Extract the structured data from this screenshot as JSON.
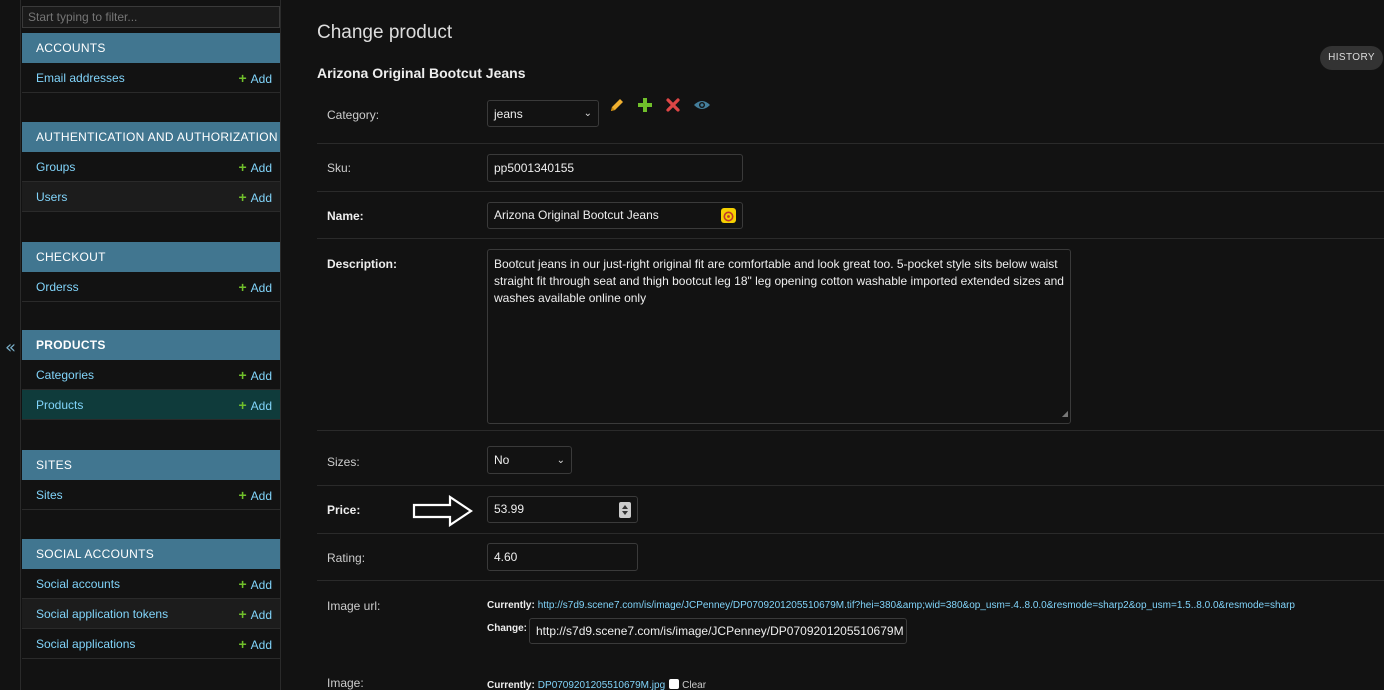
{
  "nav": {
    "filter_placeholder": "Start typing to filter...",
    "collapse_glyph": "«",
    "add_label": "Add",
    "modules": [
      {
        "caption": "ACCOUNTS",
        "models": [
          "Email addresses"
        ]
      },
      {
        "caption": "AUTHENTICATION AND AUTHORIZATION",
        "models": [
          "Groups",
          "Users"
        ]
      },
      {
        "caption": "CHECKOUT",
        "models": [
          "Orderss"
        ]
      },
      {
        "caption": "PRODUCTS",
        "models": [
          "Categories",
          "Products"
        ]
      },
      {
        "caption": "SITES",
        "models": [
          "Sites"
        ]
      },
      {
        "caption": "SOCIAL ACCOUNTS",
        "models": [
          "Social accounts",
          "Social application tokens",
          "Social applications"
        ]
      }
    ]
  },
  "main": {
    "page_title": "Change product",
    "history_label": "HISTORY",
    "object_title": "Arizona Original Bootcut Jeans"
  },
  "form": {
    "category": {
      "label": "Category:",
      "value": "jeans"
    },
    "sku": {
      "label": "Sku:",
      "value": "pp5001340155"
    },
    "name": {
      "label": "Name:",
      "value": "Arizona Original Bootcut Jeans"
    },
    "description": {
      "label": "Description:",
      "value": "Bootcut jeans in our just-right original fit are comfortable and look great too. 5-pocket style sits below waist straight fit through seat and thigh bootcut leg 18\" leg opening cotton washable imported extended sizes and washes available online only"
    },
    "sizes": {
      "label": "Sizes:",
      "value": "No"
    },
    "price": {
      "label": "Price:",
      "value": "53.99"
    },
    "rating": {
      "label": "Rating:",
      "value": "4.60"
    },
    "image_url": {
      "label": "Image url:",
      "currently_label": "Currently:",
      "currently_value": "http://s7d9.scene7.com/is/image/JCPenney/DP0709201205510679M.tif?hei=380&amp;wid=380&op_usm=.4..8.0.0&resmode=sharp2&op_usm=1.5..8.0.0&resmode=sharp",
      "change_label": "Change:",
      "change_value": "http://s7d9.scene7.com/is/image/JCPenney/DP0709201205510679M"
    },
    "image": {
      "label": "Image:",
      "currently_label": "Currently:",
      "currently_value": "DP0709201205510679M.jpg",
      "clear_label": "Clear"
    }
  },
  "colors": {
    "accent": "#417690",
    "link": "#81d4fa",
    "add_plus": "#70bf2b",
    "active_row": "#0f3b3b",
    "background": "#121212"
  }
}
